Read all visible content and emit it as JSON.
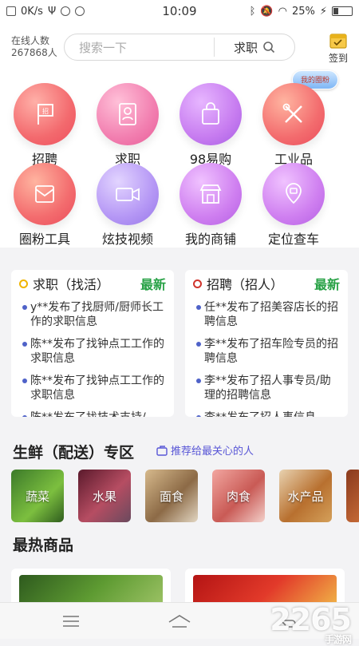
{
  "status_bar": {
    "net_speed": "0K/s",
    "time": "10:09",
    "battery": "25%",
    "battery_level": 0.25
  },
  "header": {
    "online_label": "在线人数",
    "online_count": "267868人",
    "search_placeholder": "搜索一下",
    "search_type": "求职",
    "signin_label": "签到"
  },
  "corner_badge": "我的圈粉",
  "menu": [
    {
      "label": "招聘",
      "icon": "recruit-icon"
    },
    {
      "label": "求职",
      "icon": "resume-icon"
    },
    {
      "label": "98易购",
      "icon": "shopping-bag-icon"
    },
    {
      "label": "工业品",
      "icon": "tools-icon"
    },
    {
      "label": "圈粉工具",
      "icon": "envelope-icon"
    },
    {
      "label": "炫技视频",
      "icon": "video-camera-icon"
    },
    {
      "label": "我的商铺",
      "icon": "storefront-icon"
    },
    {
      "label": "定位查车",
      "icon": "map-pin-icon"
    }
  ],
  "cards": {
    "jobseek": {
      "title": "求职（找活）",
      "badge": "最新",
      "ring_color": "#f0b400",
      "items": [
        "y**发布了找厨师/厨师长工作的求职信息",
        "陈**发布了找钟点工工作的求职信息",
        "陈**发布了找钟点工工作的求职信息",
        "陈**发布了找技术支持/"
      ]
    },
    "recruit": {
      "title": "招聘（招人）",
      "badge": "最新",
      "ring_color": "#d0342c",
      "items": [
        "任**发布了招美容店长的招聘信息",
        "李**发布了招车险专员的招聘信息",
        "李**发布了招人事专员/助理的招聘信息",
        "李**发布了招人事信息"
      ]
    }
  },
  "fresh": {
    "title": "生鲜（配送）专区",
    "recommend": "推荐给最关心的人",
    "tiles": [
      "蔬菜",
      "水果",
      "面食",
      "肉食",
      "水产品",
      ""
    ]
  },
  "hot_title": "最热商品",
  "watermark": {
    "text": "2265",
    "sub": "手游网"
  }
}
